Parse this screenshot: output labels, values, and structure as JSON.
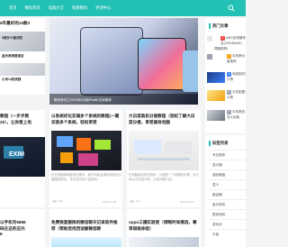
{
  "nav": {
    "items": [
      "首页",
      "数码资讯",
      "电脑大全",
      "智能数码",
      "评测中心"
    ]
  },
  "colors": {
    "accent": "#22c0b5",
    "rank_red": "#ef4444",
    "rank_orange": "#f59e0b",
    "rank_blue": "#3b82f6"
  },
  "left_column": {
    "top_headline": "6年最好的15款3",
    "items": [
      "5是什么档次的",
      "显示系统错误怎",
      "小米14的优缺"
    ],
    "lower_headline": "教程（一步步教\n25），让你爱上电",
    "bottom_headline": "以手机号9888\n码在这的这内\n8"
  },
  "hero": {
    "caption": "数码资讯之2024年5大新iPad价位和推荐",
    "icon": "tablet-icon"
  },
  "hot_panel": {
    "title": "热门文章",
    "items": [
      {
        "rank": "1",
        "text": "AMD处理器排名(2024年AMD处理器推荐)",
        "lines": [
          "AMD处理器排",
          "名(2024年AMD",
          "理器推荐)"
        ]
      },
      {
        "rank": "2",
        "text": "手机移动硬盘推荐",
        "lines": [
          "手机移动",
          "盘推荐"
        ]
      },
      {
        "rank": "3",
        "text": "电脑配件排行榜",
        "lines": [
          "电脑配件排",
          "行榜"
        ]
      },
      {
        "rank": "4",
        "text": "手机配置怎么看",
        "lines": [
          "手机配置怎",
          "么看"
        ]
      },
      {
        "rank": "5",
        "text": "手机是我了怎么回事",
        "lines": [
          "手机是我了",
          "怎么回事"
        ]
      }
    ]
  },
  "tags_panel": {
    "title": "标签列表",
    "tags": [
      "专业程序",
      "显示器",
      "固态硬盘",
      "显卡",
      "路由器",
      "蓝牙耳机",
      "数码相机",
      "游戏本",
      "平板"
    ]
  },
  "articles": [
    {
      "title": "以系统优化实操多个系统的教程(一键安装多个系统，轻松享受",
      "excerpt": "在日常使用电脑的过程中，我们可能会遇到系统运行缓慢的情况，本文将为您介绍如何...",
      "views": "301",
      "date": "2025-07-04"
    },
    {
      "title": "大白菜装机分盘教程（轻松了解大白菜分盘，享受高效电脑",
      "excerpt": "在电脑装机的过程中，分盘是一个重要的步骤。本文将以大白菜为例，为您详细介绍...",
      "views": "147",
      "date": "2025-07-04"
    },
    {
      "title": "免费恢复删除的微信聊天记录软件推荐（帮助您找回误删微信聊",
      "views": "",
      "date": ""
    },
    {
      "title": "oppo三摄实验室（领略时尚潮流，尊享超级体验）",
      "views": "",
      "date": ""
    }
  ],
  "card_icons": {
    "views": "eye-icon",
    "search": "search-icon"
  }
}
